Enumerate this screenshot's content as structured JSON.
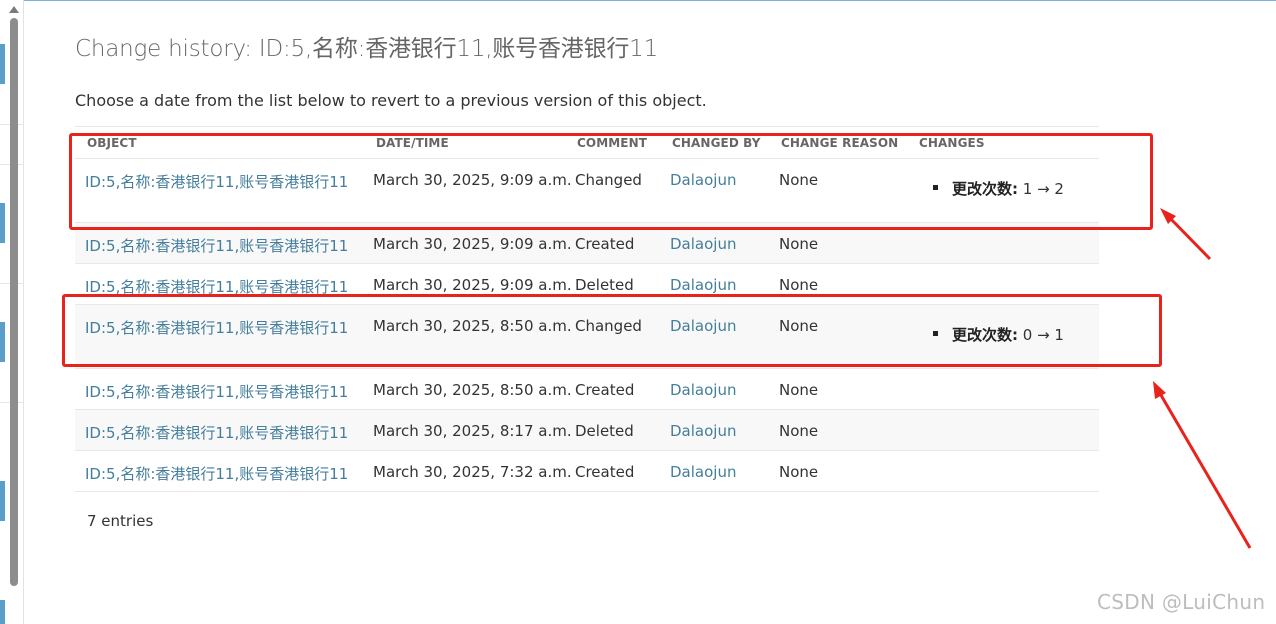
{
  "page": {
    "title": "Change history: ID:5,名称:香港银行11,账号香港银行11",
    "description": "Choose a date from the list below to revert to a previous version of this object."
  },
  "table": {
    "columns": [
      "OBJECT",
      "DATE/TIME",
      "COMMENT",
      "CHANGED BY",
      "CHANGE REASON",
      "CHANGES"
    ],
    "rows": [
      {
        "object": "ID:5,名称:香港银行11,账号香港银行11",
        "datetime": "March 30, 2025, 9:09 a.m.",
        "comment": "Changed",
        "changed_by": "Dalaojun",
        "reason": "None",
        "change_field": "更改次数:",
        "change_value": " 1  →  2"
      },
      {
        "object": "ID:5,名称:香港银行11,账号香港银行11",
        "datetime": "March 30, 2025, 9:09 a.m.",
        "comment": "Created",
        "changed_by": "Dalaojun",
        "reason": "None"
      },
      {
        "object": "ID:5,名称:香港银行11,账号香港银行11",
        "datetime": "March 30, 2025, 9:09 a.m.",
        "comment": "Deleted",
        "changed_by": "Dalaojun",
        "reason": "None"
      },
      {
        "object": "ID:5,名称:香港银行11,账号香港银行11",
        "datetime": "March 30, 2025, 8:50 a.m.",
        "comment": "Changed",
        "changed_by": "Dalaojun",
        "reason": "None",
        "change_field": "更改次数:",
        "change_value": " 0  →  1"
      },
      {
        "object": "ID:5,名称:香港银行11,账号香港银行11",
        "datetime": "March 30, 2025, 8:50 a.m.",
        "comment": "Created",
        "changed_by": "Dalaojun",
        "reason": "None"
      },
      {
        "object": "ID:5,名称:香港银行11,账号香港银行11",
        "datetime": "March 30, 2025, 8:17 a.m.",
        "comment": "Deleted",
        "changed_by": "Dalaojun",
        "reason": "None"
      },
      {
        "object": "ID:5,名称:香港银行11,账号香港银行11",
        "datetime": "March 30, 2025, 7:32 a.m.",
        "comment": "Created",
        "changed_by": "Dalaojun",
        "reason": "None"
      }
    ],
    "entries_text": "7 entries"
  },
  "watermark": "CSDN @LuiChun",
  "colors": {
    "link": "#447e9b",
    "annotation_red": "#e8231c",
    "sidebar_accent": "#5b9ec9"
  }
}
